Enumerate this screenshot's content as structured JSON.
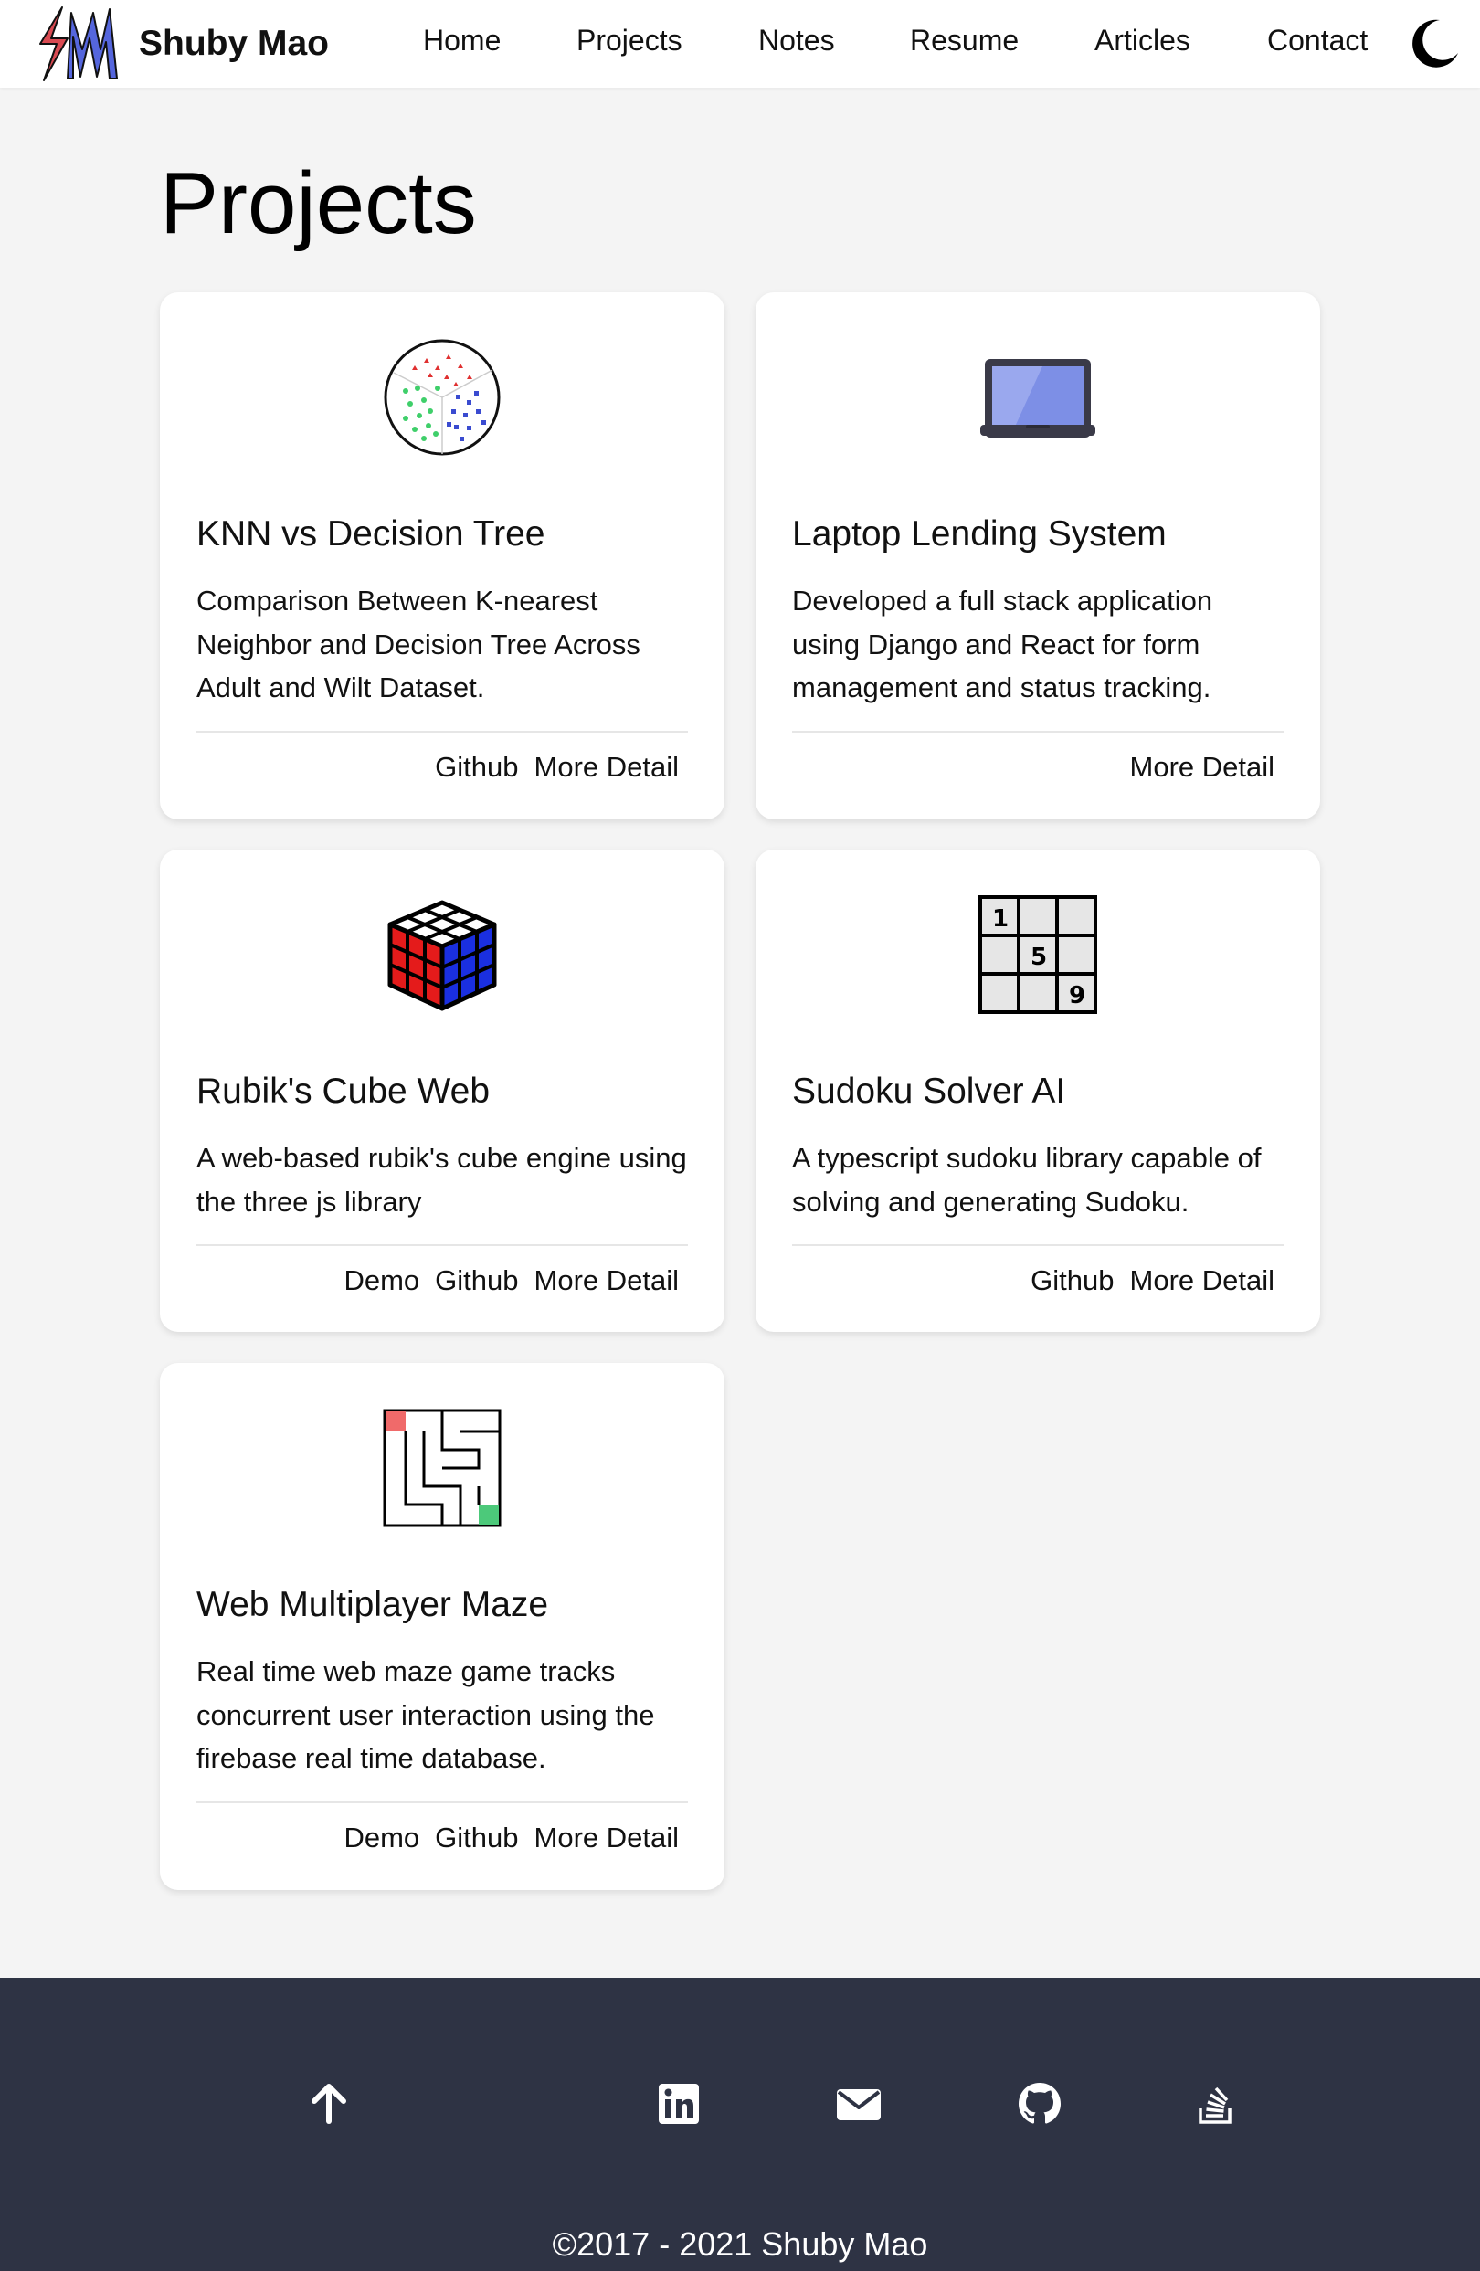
{
  "nav": {
    "brand": "Shuby Mao",
    "links": [
      "Home",
      "Projects",
      "Notes",
      "Resume",
      "Articles",
      "Contact"
    ],
    "theme_toggle_icon": "moon-icon"
  },
  "page": {
    "title": "Projects"
  },
  "projects": [
    {
      "title": "KNN vs Decision Tree",
      "description": "Comparison Between K-nearest Neighbor and Decision Tree Across Adult and Wilt Dataset.",
      "links": [
        "Github",
        "More Detail"
      ],
      "icon": "scatter-plot-icon"
    },
    {
      "title": "Laptop Lending System",
      "description": "Developed a full stack application using Django and React for form management and status tracking.",
      "links": [
        "More Detail"
      ],
      "icon": "laptop-icon"
    },
    {
      "title": "Rubik's Cube Web",
      "description": "A web-based rubik's cube engine using the three js library",
      "links": [
        "Demo",
        "Github",
        "More Detail"
      ],
      "icon": "rubiks-cube-icon"
    },
    {
      "title": "Sudoku Solver AI",
      "description": "A typescript sudoku library capable of solving and generating Sudoku.",
      "links": [
        "Github",
        "More Detail"
      ],
      "icon": "sudoku-grid-icon",
      "grid_digits": [
        "1",
        "5",
        "9"
      ]
    },
    {
      "title": "Web Multiplayer Maze",
      "description": "Real time web maze game tracks concurrent user interaction using the firebase real time database.",
      "links": [
        "Demo",
        "Github",
        "More Detail"
      ],
      "icon": "maze-icon"
    }
  ],
  "footer": {
    "icons": [
      "arrow-up-icon",
      "linkedin-icon",
      "email-icon",
      "github-icon",
      "stackoverflow-icon"
    ],
    "copyright": "©2017 - 2021 Shuby Mao"
  },
  "colors": {
    "page_bg": "#f4f4f4",
    "footer_bg": "#2e3344",
    "logo_red": "#d94a52",
    "logo_blue": "#5566dd"
  }
}
